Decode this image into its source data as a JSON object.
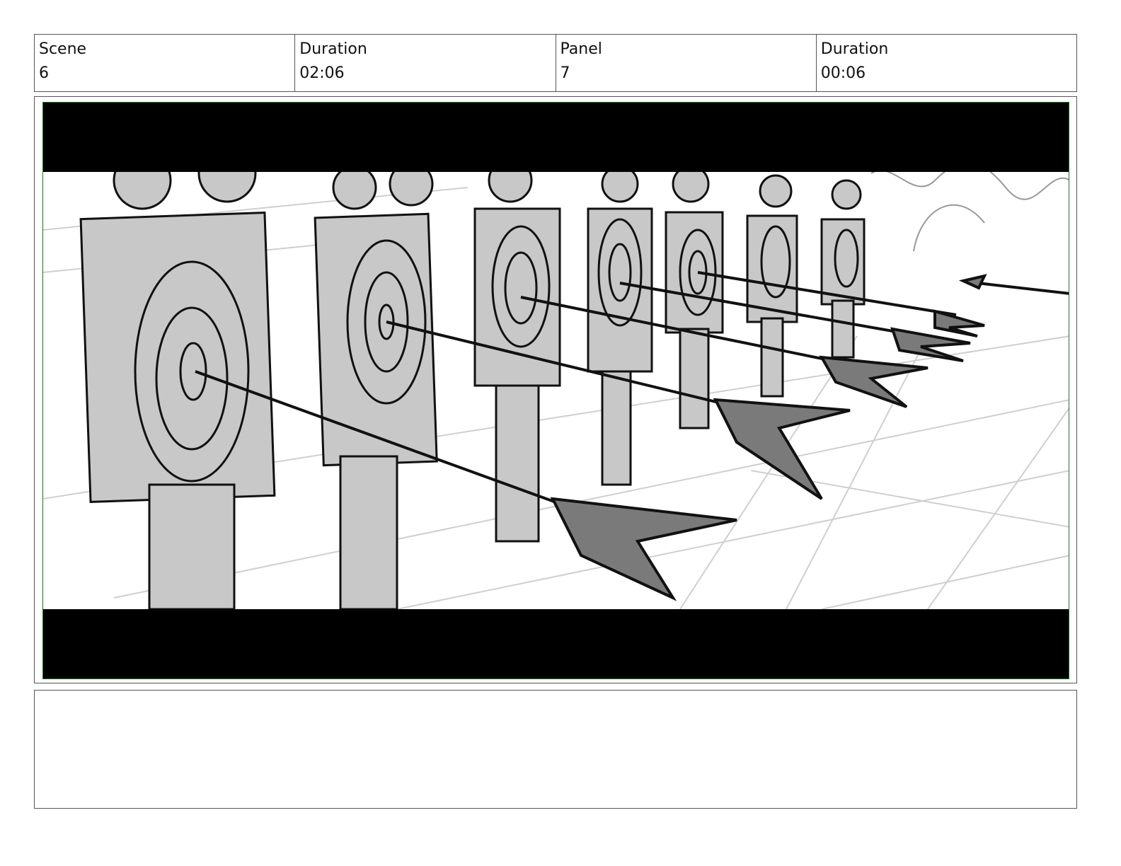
{
  "header": {
    "scene_label": "Scene",
    "scene_value": "6",
    "scene_duration_label": "Duration",
    "scene_duration_value": "02:06",
    "panel_label": "Panel",
    "panel_value": "7",
    "panel_duration_label": "Duration",
    "panel_duration_value": "00:06"
  },
  "panel": {
    "image_description_icon": "storyboard-sketch-archery-targets"
  },
  "notes": {
    "text": ""
  },
  "colors": {
    "letterbox": "#000000",
    "frame_border": "#2f6b2f",
    "sketch_fill": "#c8c8c8",
    "fletching": "#7a7a7a"
  }
}
